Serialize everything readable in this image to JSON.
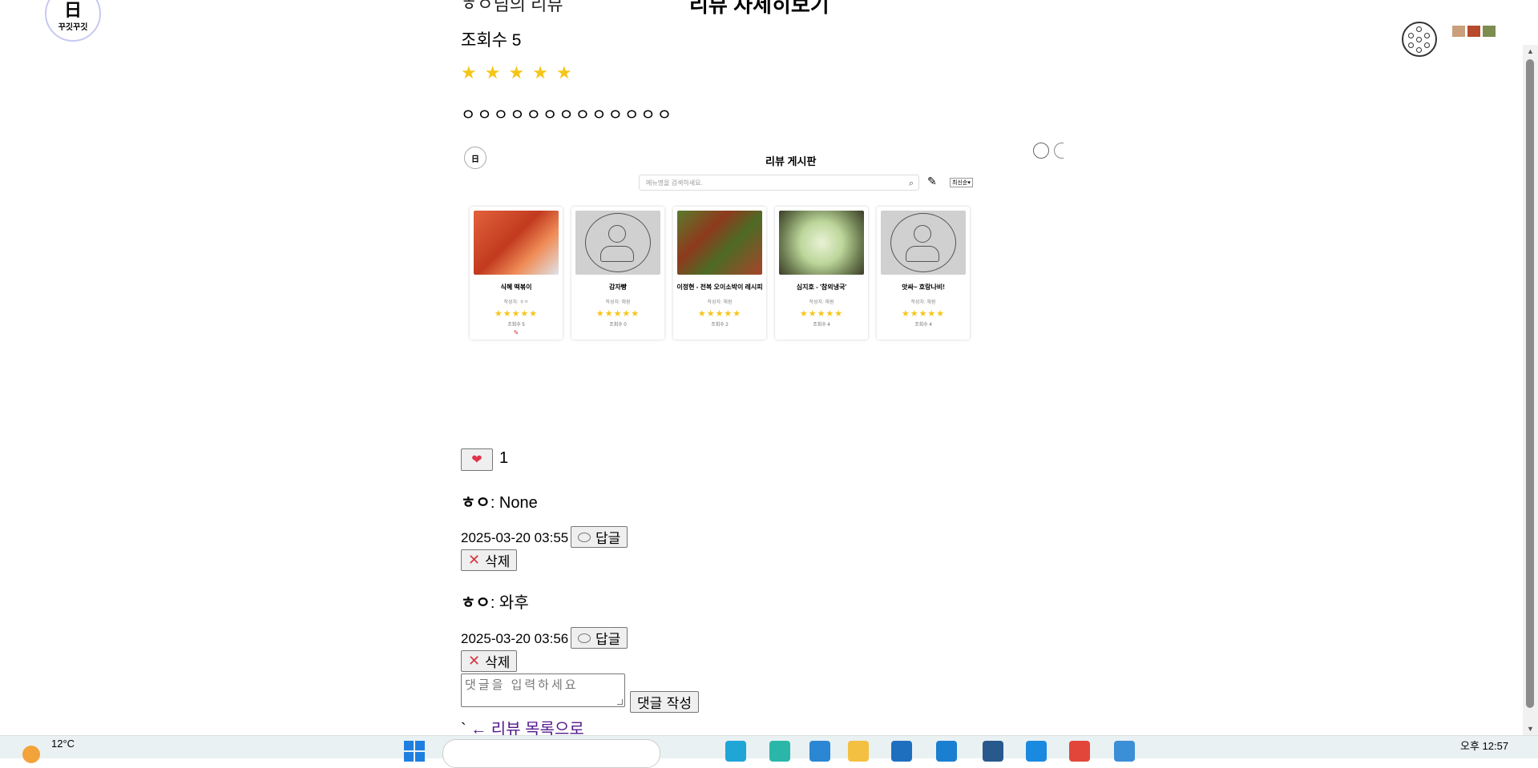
{
  "logo": {
    "glyph": "日",
    "text": "꾸깃꾸깃"
  },
  "header": {
    "author_label": "ㅎㅇ님의 리뷰",
    "title": "리뷰 자세히보기"
  },
  "review": {
    "views_label": "조회수 5",
    "rating": 5,
    "stars": [
      "★",
      "★",
      "★",
      "★",
      "★"
    ],
    "content": "ㅇㅇㅇㅇㅇㅇㅇㅇㅇㅇㅇㅇㅇ"
  },
  "embedded": {
    "logo": "日",
    "title": "리뷰 게시판",
    "search_placeholder": "메뉴명을 검색하세요.",
    "sort_label": "최신순▾",
    "cards": [
      {
        "name": "식혜 떡볶이",
        "author": "작성자: ㅎㅇ",
        "stars": "★★★★★",
        "views": "조회수 5",
        "image": "food1",
        "pencil": "✎"
      },
      {
        "name": "감자빵",
        "author": "작성자: 해원",
        "stars": "★★★★★",
        "views": "조회수 0",
        "image": "placeholder"
      },
      {
        "name": "이정현 - 전복 오이소박이 레시피",
        "author": "작성자: 해원",
        "stars": "★★★★★",
        "views": "조회수 2",
        "image": "food2"
      },
      {
        "name": "심지호 - '참외냉국'",
        "author": "작성자: 해원",
        "stars": "★★★★★",
        "views": "조회수 4",
        "image": "food3"
      },
      {
        "name": "앗싸~ 호랑나비!",
        "author": "작성자: 해원",
        "stars": "★★★★★",
        "views": "조회수 4",
        "image": "placeholder"
      }
    ]
  },
  "like": {
    "icon": "heart-icon",
    "count": "1"
  },
  "comments": [
    {
      "user": "ㅎㅇ",
      "text": ": None",
      "date": "2025-03-20 03:55",
      "reply_label": "답글",
      "delete_label": "삭제"
    },
    {
      "user": "ㅎㅇ",
      "text": ": 와후",
      "date": "2025-03-20 03:56",
      "reply_label": "답글",
      "delete_label": "삭제"
    }
  ],
  "comment_form": {
    "placeholder": "댓글을 입력하세요",
    "submit_label": "댓글 작성"
  },
  "back": {
    "prefix": "`",
    "link_label": "← 리뷰 목록으로"
  },
  "taskbar": {
    "temperature": "12°C",
    "time": "오후 12:57"
  },
  "colors": {
    "star": "#f5c518",
    "heart": "#e0334a",
    "delete_x": "#d8343e",
    "link": "#551a8b"
  }
}
